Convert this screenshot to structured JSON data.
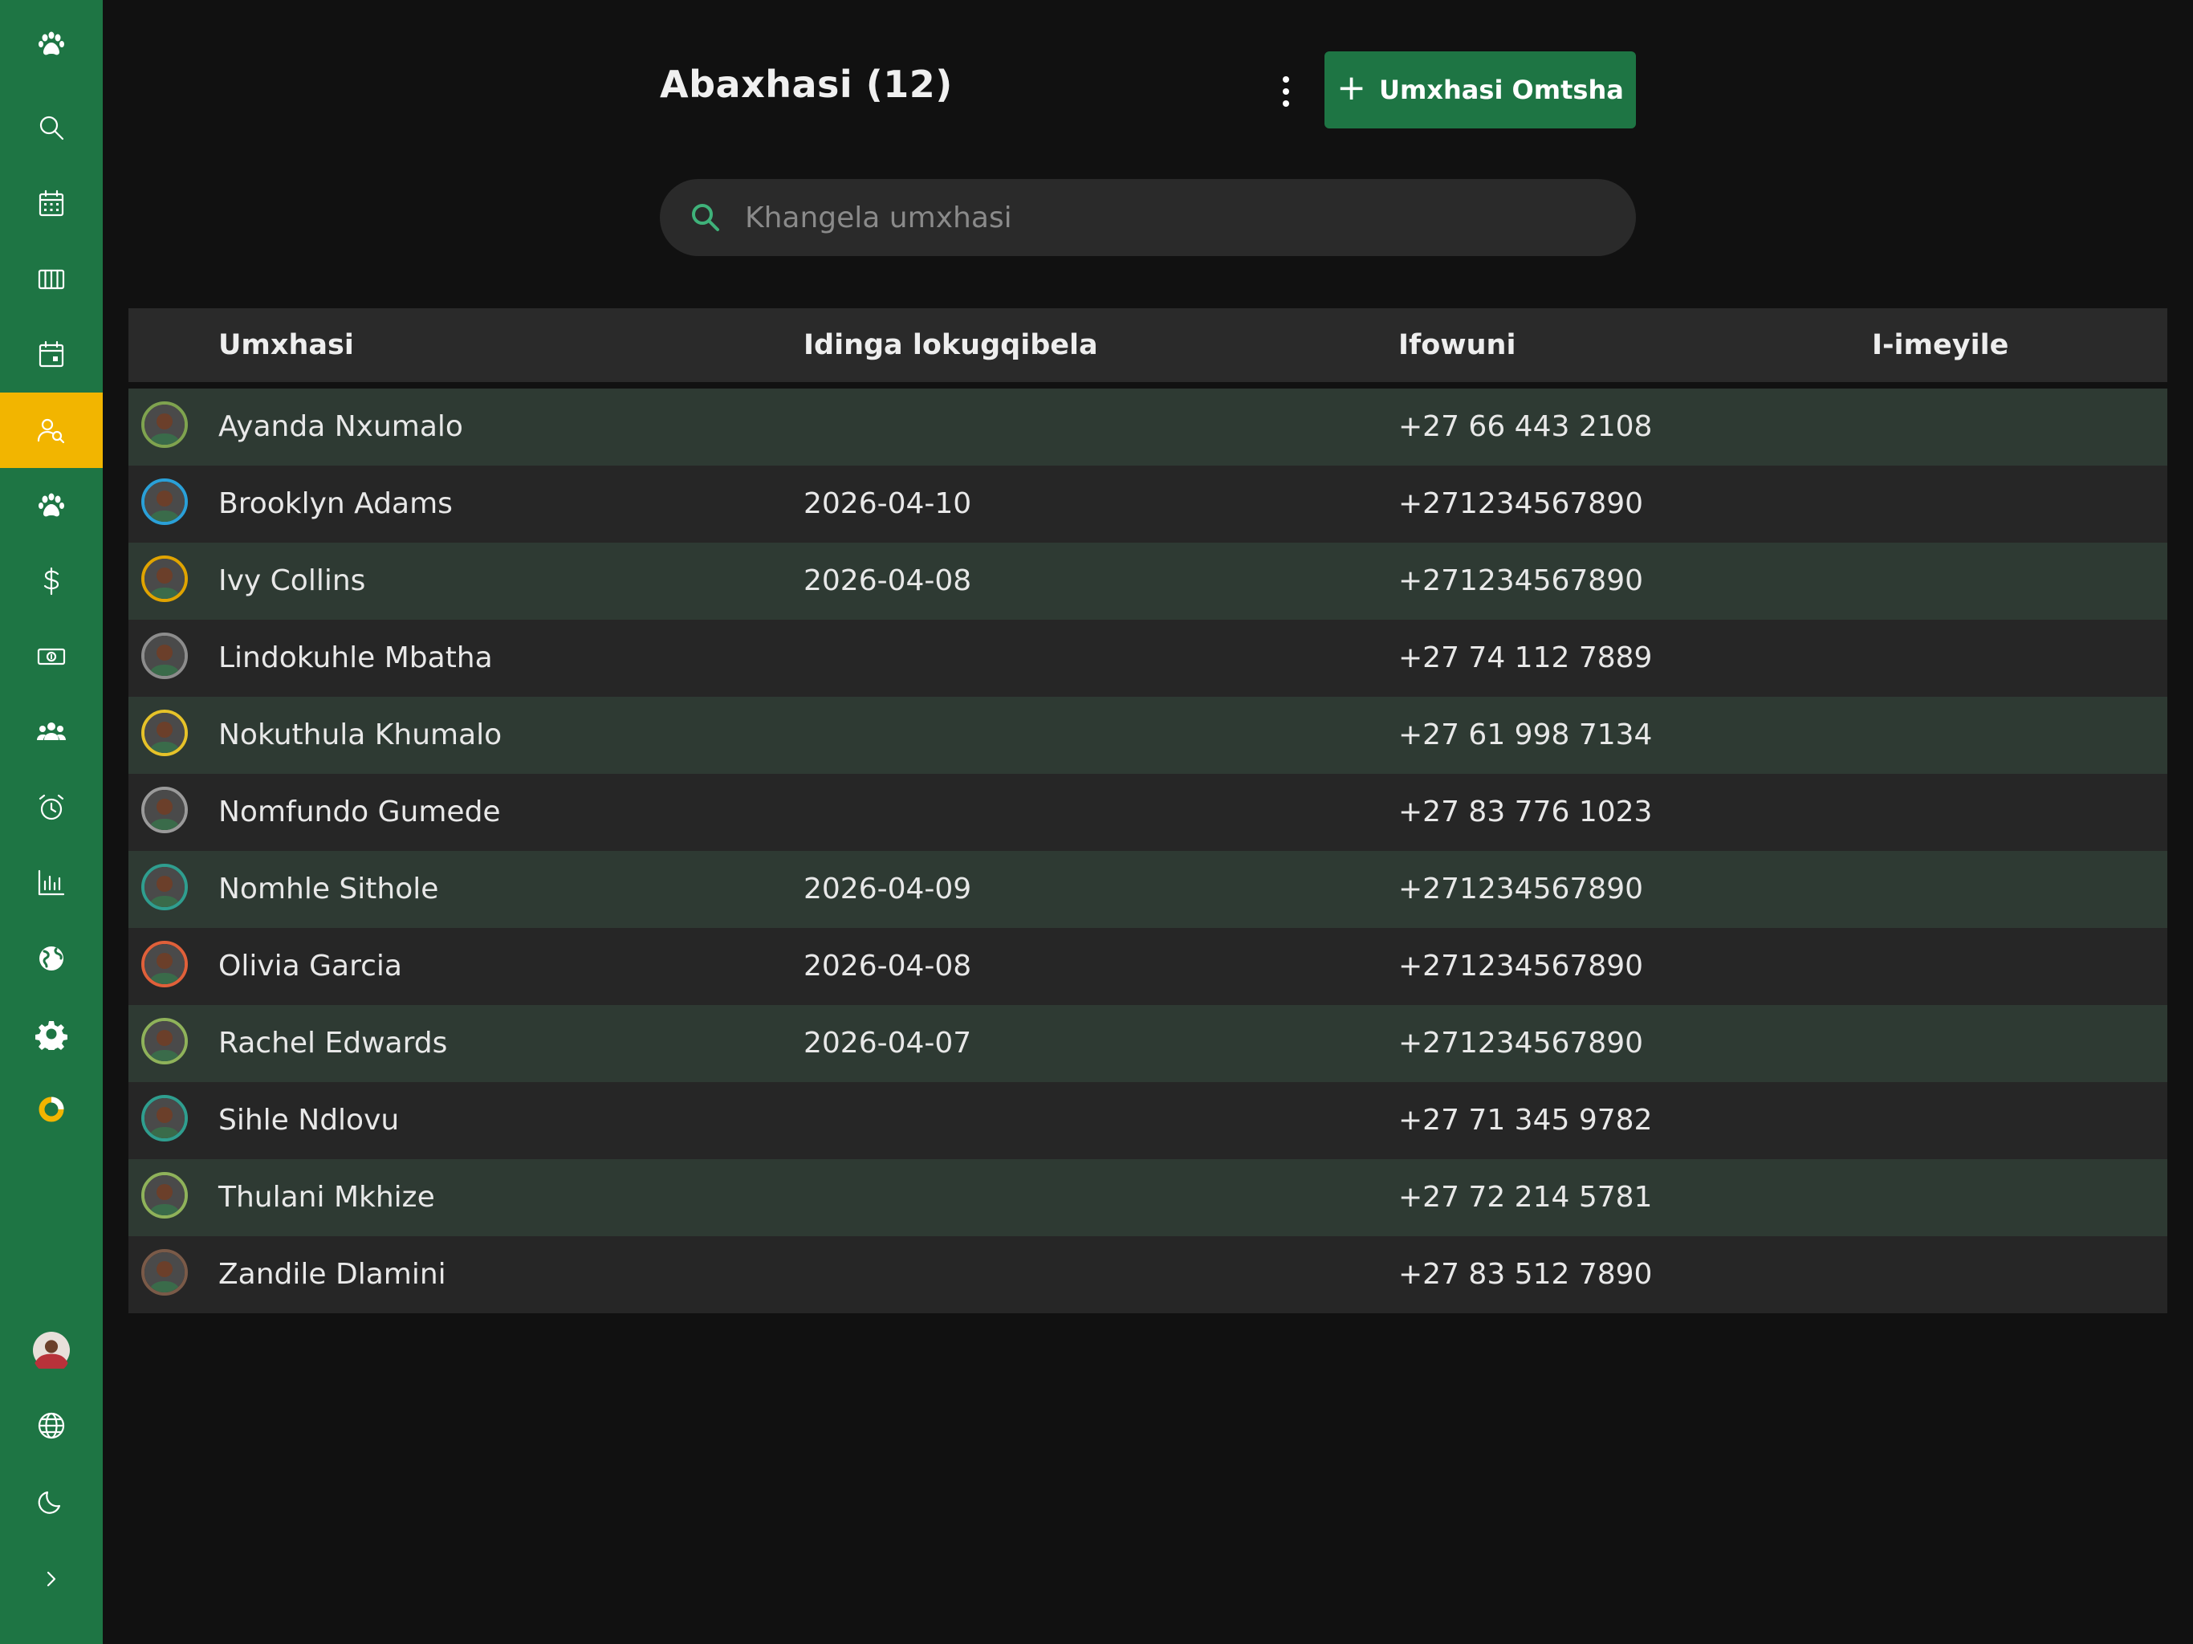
{
  "sidebar": {
    "items": [
      {
        "icon": "paw-logo-icon"
      },
      {
        "icon": "search-icon"
      },
      {
        "icon": "calendar-icon"
      },
      {
        "icon": "columns-icon"
      },
      {
        "icon": "calendar-day-icon"
      },
      {
        "icon": "client-search-icon",
        "active": true
      },
      {
        "icon": "paw-icon"
      },
      {
        "icon": "dollar-icon"
      },
      {
        "icon": "cash-icon"
      },
      {
        "icon": "users-icon"
      },
      {
        "icon": "alarm-icon"
      },
      {
        "icon": "bar-chart-icon"
      },
      {
        "icon": "globe-filled-icon"
      },
      {
        "icon": "gear-icon"
      },
      {
        "icon": "ring-icon"
      }
    ],
    "bottom": [
      {
        "icon": "profile-avatar"
      },
      {
        "icon": "language-icon"
      },
      {
        "icon": "moon-icon"
      },
      {
        "icon": "chevron-right-icon"
      }
    ],
    "active_color": "#f2b500",
    "bg_color": "#1e7544"
  },
  "header": {
    "title": "Abaxhasi (12)",
    "new_button_label": "Umxhasi Omtsha"
  },
  "search": {
    "placeholder": "Khangela umxhasi",
    "value": ""
  },
  "table": {
    "columns": [
      "Umxhasi",
      "Idinga lokugqibela",
      "Ifowuni",
      "I-imeyile"
    ],
    "rows": [
      {
        "name": "Ayanda Nxumalo",
        "last_appointment": "",
        "phone": "+27 66 443 2108",
        "email": "",
        "ring": "#7fa34f"
      },
      {
        "name": "Brooklyn Adams",
        "last_appointment": "2026-04-10",
        "phone": "+271234567890",
        "email": "",
        "ring": "#2aa0d8"
      },
      {
        "name": "Ivy Collins",
        "last_appointment": "2026-04-08",
        "phone": "+271234567890",
        "email": "",
        "ring": "#e0a400"
      },
      {
        "name": "Lindokuhle Mbatha",
        "last_appointment": "",
        "phone": "+27 74 112 7889",
        "email": "",
        "ring": "#8c8c8c"
      },
      {
        "name": "Nokuthula Khumalo",
        "last_appointment": "",
        "phone": "+27 61 998 7134",
        "email": "",
        "ring": "#e6c229"
      },
      {
        "name": "Nomfundo Gumede",
        "last_appointment": "",
        "phone": "+27 83 776 1023",
        "email": "",
        "ring": "#9a9a9a"
      },
      {
        "name": "Nomhle Sithole",
        "last_appointment": "2026-04-09",
        "phone": "+271234567890",
        "email": "",
        "ring": "#2f9e8f"
      },
      {
        "name": "Olivia Garcia",
        "last_appointment": "2026-04-08",
        "phone": "+271234567890",
        "email": "",
        "ring": "#e0603a"
      },
      {
        "name": "Rachel Edwards",
        "last_appointment": "2026-04-07",
        "phone": "+271234567890",
        "email": "",
        "ring": "#8fb25a"
      },
      {
        "name": "Sihle Ndlovu",
        "last_appointment": "",
        "phone": "+27 71 345 9782",
        "email": "",
        "ring": "#2f9e8f"
      },
      {
        "name": "Thulani Mkhize",
        "last_appointment": "",
        "phone": "+27 72 214 5781",
        "email": "",
        "ring": "#8fb25a"
      },
      {
        "name": "Zandile Dlamini",
        "last_appointment": "",
        "phone": "+27 83 512 7890",
        "email": "",
        "ring": "#7a5a48"
      }
    ]
  }
}
